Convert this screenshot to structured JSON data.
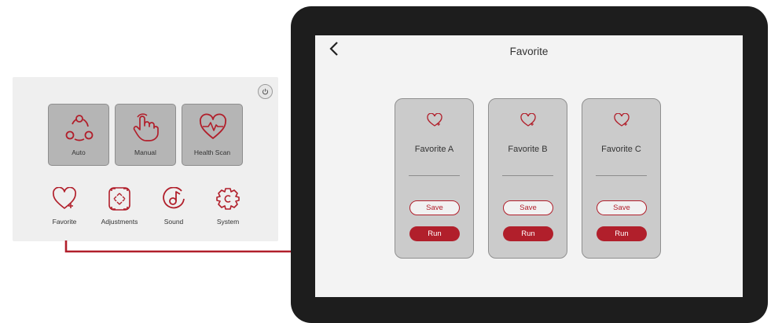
{
  "colors": {
    "accent": "#b11f2b",
    "tile_bg": "#b5b5b5",
    "card_bg": "#cbcbcb",
    "device_frame": "#1d1d1d"
  },
  "home": {
    "power_icon": "power-icon",
    "tiles": [
      {
        "label": "Auto",
        "icon": "auto-cycle-icon"
      },
      {
        "label": "Manual",
        "icon": "hand-pointer-icon"
      },
      {
        "label": "Health Scan",
        "icon": "heart-pulse-icon"
      }
    ],
    "menu": [
      {
        "label": "Favorite",
        "icon": "heart-plus-icon"
      },
      {
        "label": "Adjustments",
        "icon": "adjust-arrows-icon"
      },
      {
        "label": "Sound",
        "icon": "music-note-icon"
      },
      {
        "label": "System",
        "icon": "gear-icon"
      }
    ]
  },
  "favorite_screen": {
    "title": "Favorite",
    "back_icon": "back-chevron-icon",
    "cards": [
      {
        "name": "Favorite A",
        "save": "Save",
        "run": "Run"
      },
      {
        "name": "Favorite B",
        "save": "Save",
        "run": "Run"
      },
      {
        "name": "Favorite C",
        "save": "Save",
        "run": "Run"
      }
    ]
  }
}
